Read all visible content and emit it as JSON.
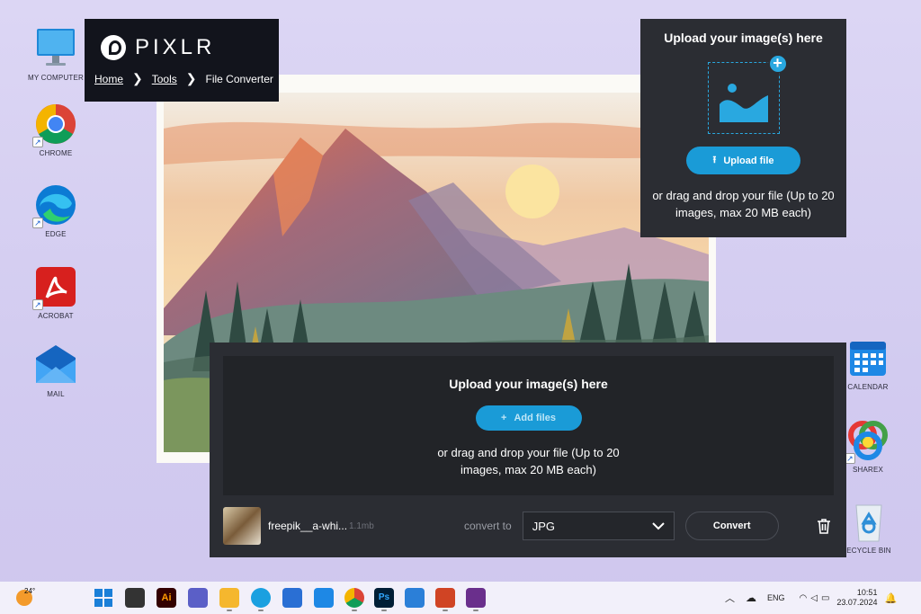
{
  "desktop": {
    "icons": [
      {
        "label": "MY COMPUTER",
        "icon": "monitor-icon"
      },
      {
        "label": "CHROME",
        "icon": "chrome-icon"
      },
      {
        "label": "EDGE",
        "icon": "edge-icon"
      },
      {
        "label": "ACROBAT",
        "icon": "acrobat-icon"
      },
      {
        "label": "MAIL",
        "icon": "mail-icon"
      },
      {
        "label": "CALENDAR",
        "icon": "calendar-icon"
      },
      {
        "label": "SHAREX",
        "icon": "sharex-icon"
      },
      {
        "label": "ECYCLE BIN",
        "icon": "recycle-bin-icon"
      }
    ]
  },
  "pixlr": {
    "logo_text": "PIXLR",
    "breadcrumb": [
      "Home",
      "Tools",
      "File Converter"
    ]
  },
  "upload_card": {
    "title": "Upload your image(s) here",
    "button_label": "Upload file",
    "hint": "or drag and drop your file (Up to 20 images, max 20 MB each)"
  },
  "converter": {
    "title": "Upload your image(s) here",
    "add_files_label": "Add files",
    "hint": "or drag and drop your file (Up to 20 images, max 20 MB each)",
    "file": {
      "name": "freepik__a-whi...",
      "size": "1.1mb"
    },
    "convert_to_label": "convert to",
    "format_selected": "JPG",
    "convert_button": "Convert"
  },
  "taskbar": {
    "weather_temp": "24°",
    "language": "ENG",
    "time": "10:51",
    "date": "23.07.2024"
  },
  "colors": {
    "accent": "#1a9bd7",
    "panel": "#2b2d33",
    "nav": "#12141c"
  }
}
